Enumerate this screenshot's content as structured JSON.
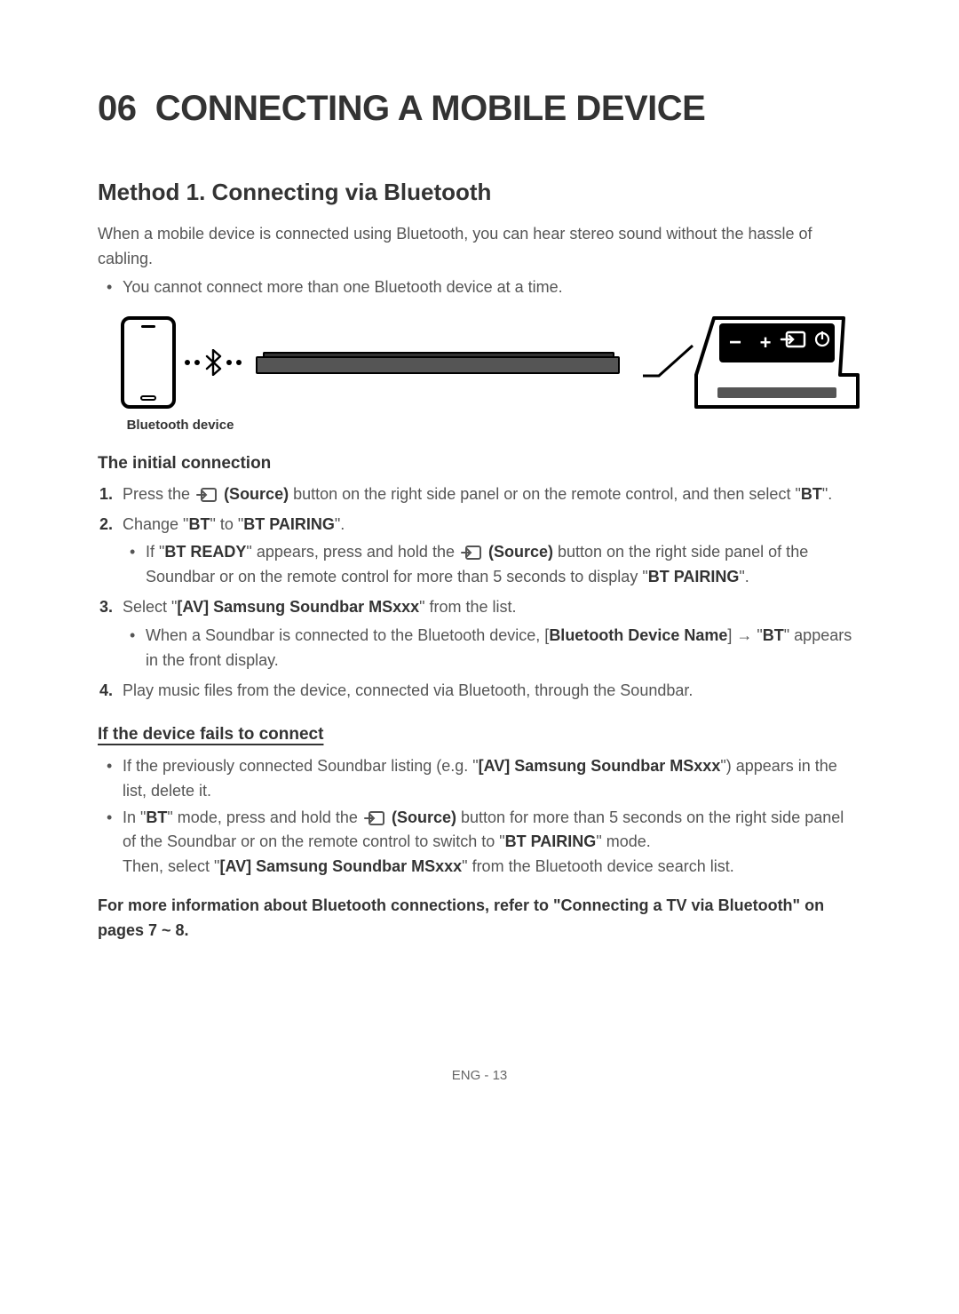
{
  "chapter": {
    "num": "06",
    "title": "CONNECTING A MOBILE DEVICE"
  },
  "section": {
    "title": "Method 1. Connecting via Bluetooth"
  },
  "intro": "When a mobile device is connected using Bluetooth, you can hear stereo sound without the hassle of cabling.",
  "intro_bullet": "You cannot connect more than one Bluetooth device at a time.",
  "figure": {
    "caption": "Bluetooth device",
    "panel": {
      "minus": "−",
      "plus": "+",
      "source_label": "source-icon",
      "power_label": "power-icon"
    }
  },
  "initial": {
    "heading": "The initial connection",
    "steps": {
      "s1a": "Press the ",
      "s1_source": "(Source)",
      "s1b": " button on the right side panel or on the remote control, and then select \"",
      "s1_bt": "BT",
      "s1c": "\".",
      "s2a": "Change \"",
      "s2_bt": "BT",
      "s2b": "\" to \"",
      "s2_btp": "BT PAIRING",
      "s2c": "\".",
      "s2_sub_a": "If \"",
      "s2_sub_btr": "BT READY",
      "s2_sub_b": "\" appears, press and hold the ",
      "s2_sub_src": "(Source)",
      "s2_sub_c": " button on the right side panel of the Soundbar or on the remote control for more than 5 seconds to display \"",
      "s2_sub_btp": "BT PAIRING",
      "s2_sub_d": "\".",
      "s3a": "Select \"",
      "s3_av": "[AV] Samsung Soundbar MSxxx",
      "s3b": "\" from the list.",
      "s3_sub_a": "When a Soundbar is connected to the Bluetooth device, [",
      "s3_sub_bdn": "Bluetooth Device Name",
      "s3_sub_b": "] → \"",
      "s3_sub_bt": "BT",
      "s3_sub_c": "\" appears in the front display.",
      "s4": "Play music files from the device, connected via Bluetooth, through the Soundbar."
    }
  },
  "fails": {
    "heading": "If the device fails to connect",
    "b1a": "If the previously connected Soundbar listing (e.g. \"",
    "b1_av": "[AV] Samsung Soundbar MSxxx",
    "b1b": "\") appears in the list, delete it.",
    "b2a": "In \"",
    "b2_bt": "BT",
    "b2b": "\" mode, press and hold the ",
    "b2_src": "(Source)",
    "b2c": " button for more than 5 seconds on the right side panel of the Soundbar or on the remote control to switch to \"",
    "b2_btp": "BT PAIRING",
    "b2d": "\" mode.",
    "b2e": "Then, select \"",
    "b2_av": "[AV] Samsung Soundbar MSxxx",
    "b2f": "\" from the Bluetooth device search list."
  },
  "xref": "For more information about Bluetooth connections, refer to \"Connecting a TV via Bluetooth\" on pages 7 ~ 8.",
  "footer": "ENG - 13"
}
